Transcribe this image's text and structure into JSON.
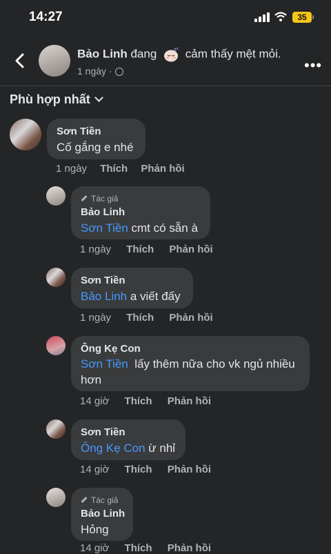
{
  "status_bar": {
    "time": "14:27",
    "battery": "35"
  },
  "header": {
    "author": "Bảo Linh",
    "activity_pre": "đang",
    "activity_post": "cảm thấy mệt mỏi.",
    "feeling_icon": "sleepy-face-icon",
    "time": "1 ngày"
  },
  "sort": {
    "label": "Phù hợp nhất"
  },
  "colors": {
    "background": "#242526",
    "bubble": "#3a3b3c",
    "mention": "#4599ff",
    "battery": "#f5c518"
  },
  "comments": [
    {
      "name": "Sơn Tiền",
      "text": "Cố gắng e nhé",
      "time": "1 ngày",
      "like": "Thích",
      "reply": "Phản hồi"
    },
    {
      "author_tag": "Tác giả",
      "name": "Bảo Linh",
      "mention": "Sơn Tiền",
      "text": " cmt có sẵn à",
      "time": "1 ngày",
      "like": "Thích",
      "reply": "Phản hồi"
    },
    {
      "name": "Sơn Tiền",
      "mention": "Bảo Linh",
      "text": " a viết đấy",
      "time": "1 ngày",
      "like": "Thích",
      "reply": "Phản hồi"
    },
    {
      "name": "Ông Kẹ Con",
      "mention": "Sơn Tiền",
      "text": "  lấy thêm nữa cho vk ngủ nhiều hơn",
      "time": "14 giờ",
      "like": "Thích",
      "reply": "Phản hồi"
    },
    {
      "name": "Sơn Tiền",
      "mention": "Ông Kẹ Con",
      "text": " ừ nhỉ",
      "time": "14 giờ",
      "like": "Thích",
      "reply": "Phản hồi"
    },
    {
      "author_tag": "Tác giả",
      "name": "Bảo Linh",
      "text": "Hỏng",
      "time": "14 giờ",
      "like": "Thích",
      "reply": "Phản hồi"
    }
  ]
}
